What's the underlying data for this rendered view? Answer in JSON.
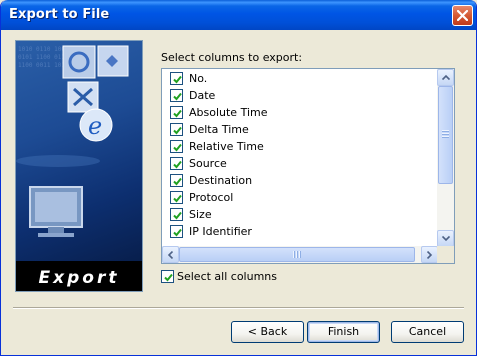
{
  "window": {
    "title": "Export to File"
  },
  "banner": {
    "caption": "Export"
  },
  "columns": {
    "label": "Select columns to export:",
    "items": [
      {
        "label": "No.",
        "checked": true
      },
      {
        "label": "Date",
        "checked": true
      },
      {
        "label": "Absolute Time",
        "checked": true
      },
      {
        "label": "Delta Time",
        "checked": true
      },
      {
        "label": "Relative Time",
        "checked": true
      },
      {
        "label": "Source",
        "checked": true
      },
      {
        "label": "Destination",
        "checked": true
      },
      {
        "label": "Protocol",
        "checked": true
      },
      {
        "label": "Size",
        "checked": true
      },
      {
        "label": "IP Identifier",
        "checked": true
      }
    ]
  },
  "select_all": {
    "label": "Select all columns",
    "checked": true
  },
  "buttons": {
    "back": "< Back",
    "finish": "Finish",
    "cancel": "Cancel"
  },
  "colors": {
    "titlebar": "#0055e5",
    "checkmark": "#21a121",
    "window_bg": "#ece9d8"
  }
}
